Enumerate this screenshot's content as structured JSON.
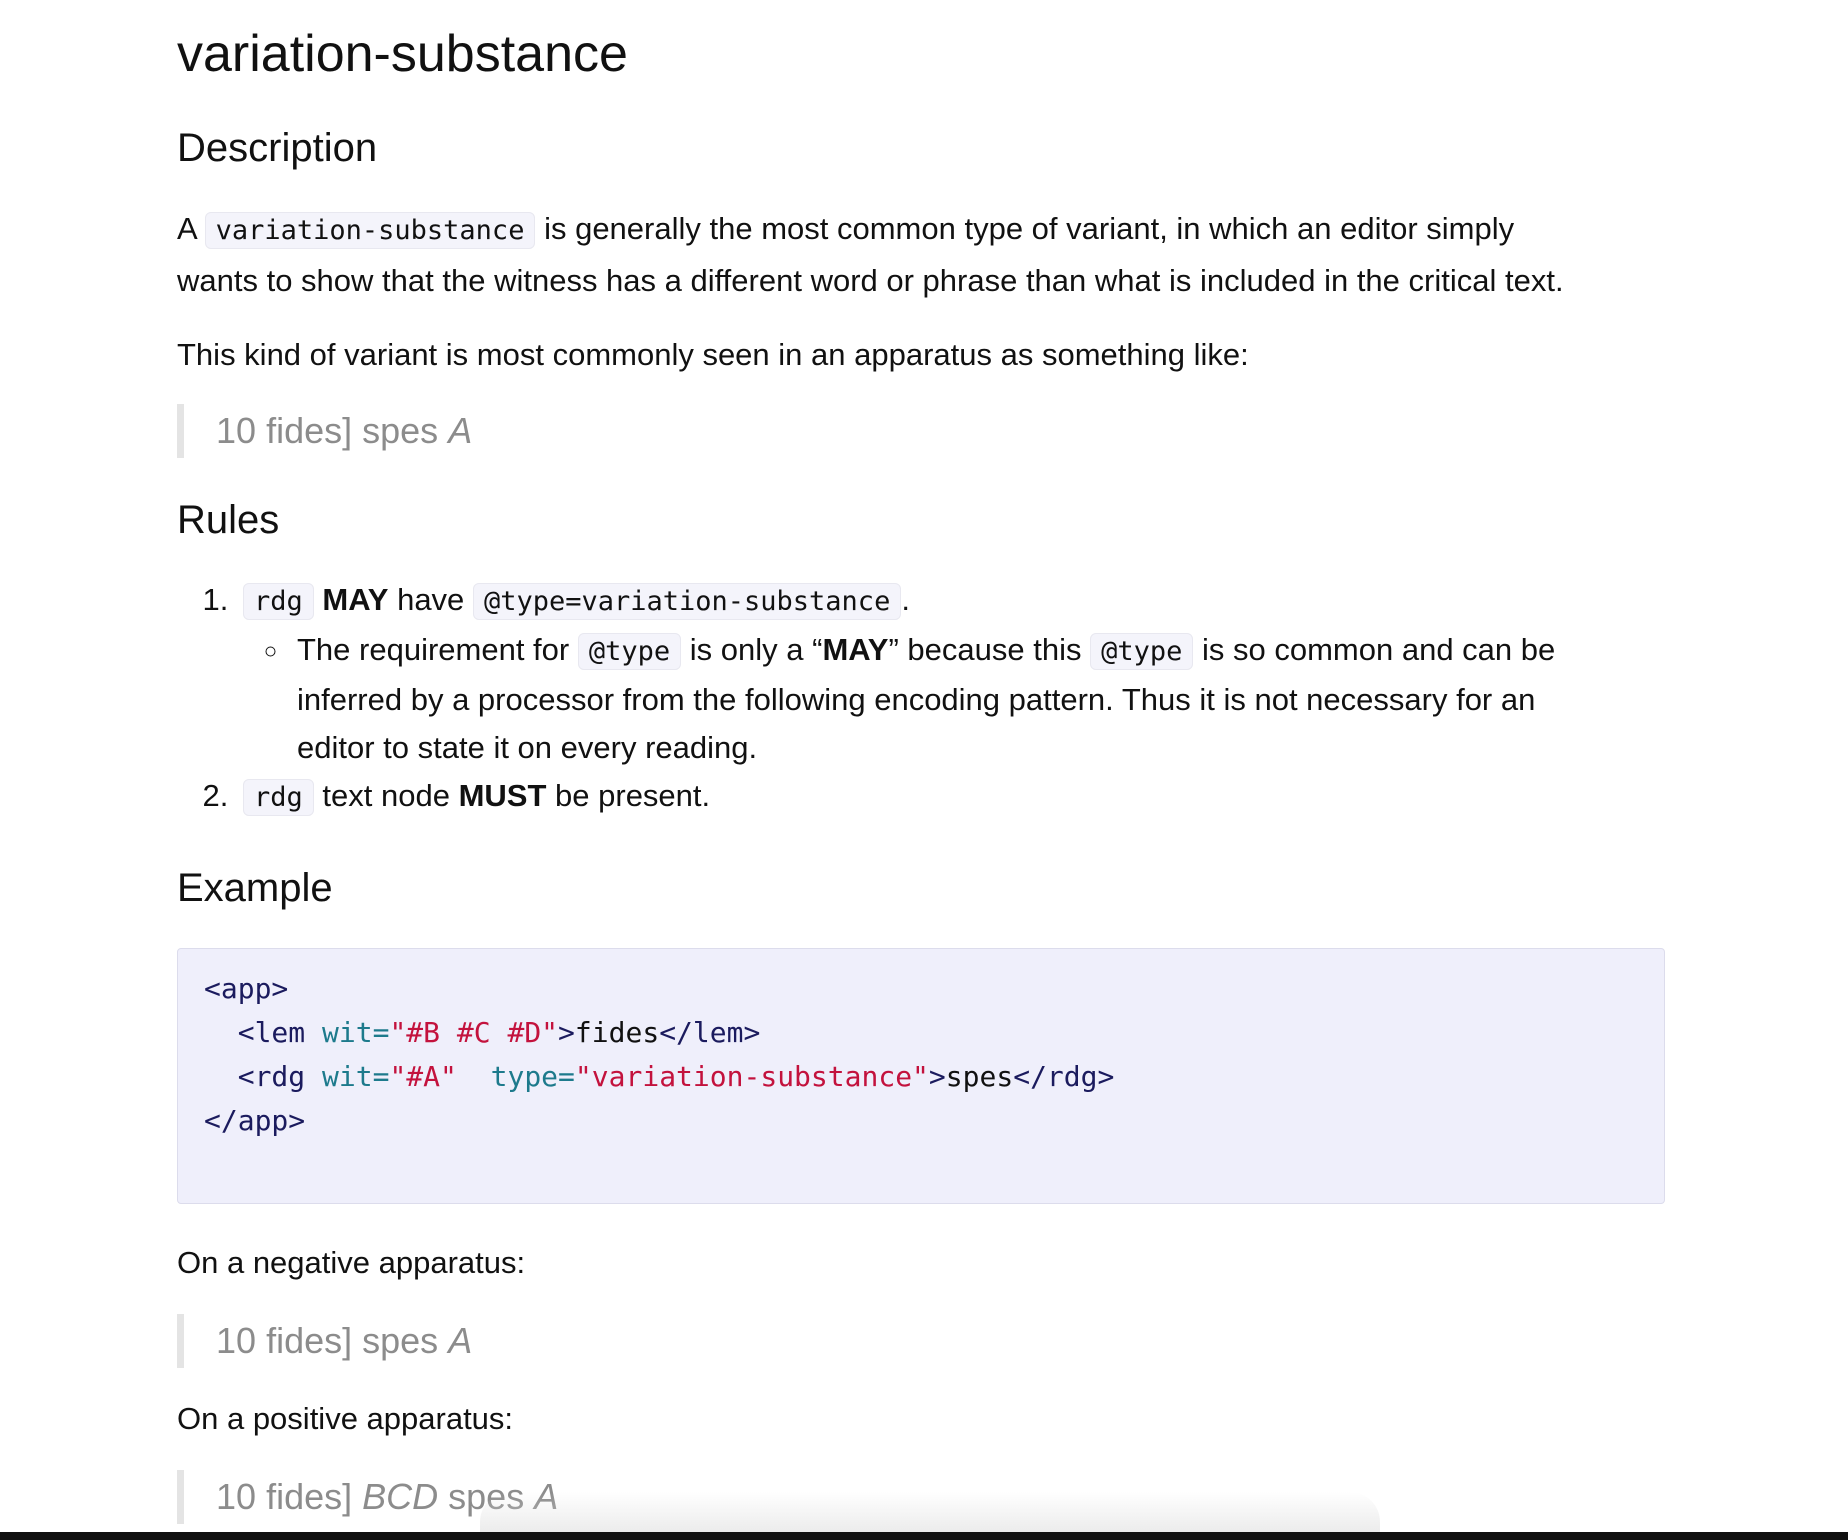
{
  "title": "variation-substance",
  "description": {
    "heading": "Description",
    "p1_pre": "A",
    "p1_code": "variation-substance",
    "p1_line1_post": "is generally the most common type of variant, in which an editor simply",
    "p1_line2": "wants to show that the witness has a different word or phrase than what is included in the critical text.",
    "p2": "This kind of variant is most commonly seen in an apparatus as something like:",
    "quote": {
      "line_num": "10",
      "lemma": "fides]",
      "reading": "spes",
      "siglum": "A"
    }
  },
  "rules": {
    "heading": "Rules",
    "r1": {
      "code1": "rdg",
      "strong": "MAY",
      "mid": "have",
      "code2": "@type=variation-substance",
      "end": ".",
      "sub": {
        "pre": "The requirement for",
        "code": "@type",
        "mid1": "is only a “",
        "strong": "MAY",
        "mid2": "” because this",
        "code2": "@type",
        "post": "is so common and can be",
        "line2": "inferred by a processor from the following encoding pattern. Thus it is not necessary for an",
        "line3": "editor to state it on every reading."
      }
    },
    "r2": {
      "code": "rdg",
      "pre": "text node",
      "strong": "MUST",
      "post": "be present."
    }
  },
  "example": {
    "heading": "Example",
    "code": {
      "l1": "<app>",
      "l2_open": "  <lem",
      "l2_attr": "wit=",
      "l2_val": "\"#B #C #D\"",
      "l2_close": ">",
      "l2_text": "fides",
      "l2_end": "</lem>",
      "l3_open": "  <rdg",
      "l3_attr1": "wit=",
      "l3_val1": "\"#A\"",
      "l3_attr2": "type=",
      "l3_val2": "\"variation-substance\"",
      "l3_close": ">",
      "l3_text": "spes",
      "l3_end": "</rdg>",
      "l4": "</app>"
    }
  },
  "negative": {
    "label": "On a negative apparatus:",
    "quote": {
      "line_num": "10",
      "lemma": "fides]",
      "reading": "spes",
      "siglum": "A"
    }
  },
  "positive": {
    "label": "On a positive apparatus:",
    "quote": {
      "line_num": "10",
      "lemma": "fides]",
      "witnesses": "BCD",
      "reading": "spes",
      "siglum": "A"
    }
  },
  "colors": {
    "code_background": "#efeffb",
    "tag": "#1b1b5e",
    "attribute": "#1d7a8c",
    "value": "#c3123d",
    "blockquote_text": "#8c8c8c"
  }
}
